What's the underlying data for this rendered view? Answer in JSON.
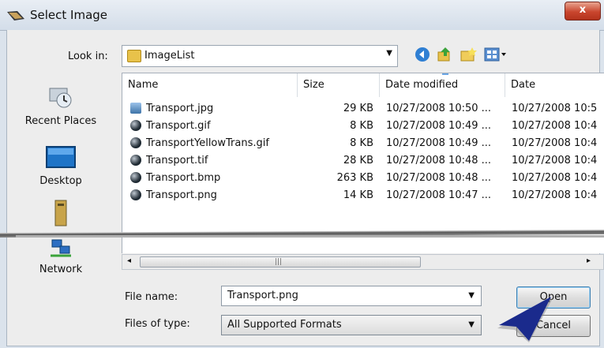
{
  "window": {
    "title": "Select Image",
    "close_label": "x"
  },
  "lookin": {
    "label": "Look in:",
    "value": "ImageList"
  },
  "places": [
    {
      "label": "Recent Places",
      "icon": "recent-places-icon"
    },
    {
      "label": "Desktop",
      "icon": "desktop-icon"
    },
    {
      "label": "",
      "icon": "computer-icon"
    },
    {
      "label": "Network",
      "icon": "network-icon"
    }
  ],
  "columns": [
    {
      "label": "Name"
    },
    {
      "label": "Size"
    },
    {
      "label": "Date modified"
    },
    {
      "label": "Date"
    }
  ],
  "files": [
    {
      "name": "Transport.jpg",
      "size": "29 KB",
      "modified": "10/27/2008 10:50 ...",
      "date": "10/27/2008 10:5",
      "type": "jpg"
    },
    {
      "name": "Transport.gif",
      "size": "8 KB",
      "modified": "10/27/2008 10:49 ...",
      "date": "10/27/2008 10:4",
      "type": "gif"
    },
    {
      "name": "TransportYellowTrans.gif",
      "size": "8 KB",
      "modified": "10/27/2008 10:49 ...",
      "date": "10/27/2008 10:4",
      "type": "gif"
    },
    {
      "name": "Transport.tif",
      "size": "28 KB",
      "modified": "10/27/2008 10:48 ...",
      "date": "10/27/2008 10:4",
      "type": "tif"
    },
    {
      "name": "Transport.bmp",
      "size": "263 KB",
      "modified": "10/27/2008 10:48 ...",
      "date": "10/27/2008 10:4",
      "type": "bmp"
    },
    {
      "name": "Transport.png",
      "size": "14 KB",
      "modified": "10/27/2008 10:47 ...",
      "date": "10/27/2008 10:4",
      "type": "png"
    }
  ],
  "filename": {
    "label": "File name:",
    "value": "Transport.png"
  },
  "filetype": {
    "label": "Files of type:",
    "value": "All Supported Formats"
  },
  "buttons": {
    "open": "Open",
    "cancel": "Cancel"
  },
  "colors": {
    "accent": "#3c7fb1",
    "close": "#c9462e",
    "pointer": "#1a2a8c"
  }
}
